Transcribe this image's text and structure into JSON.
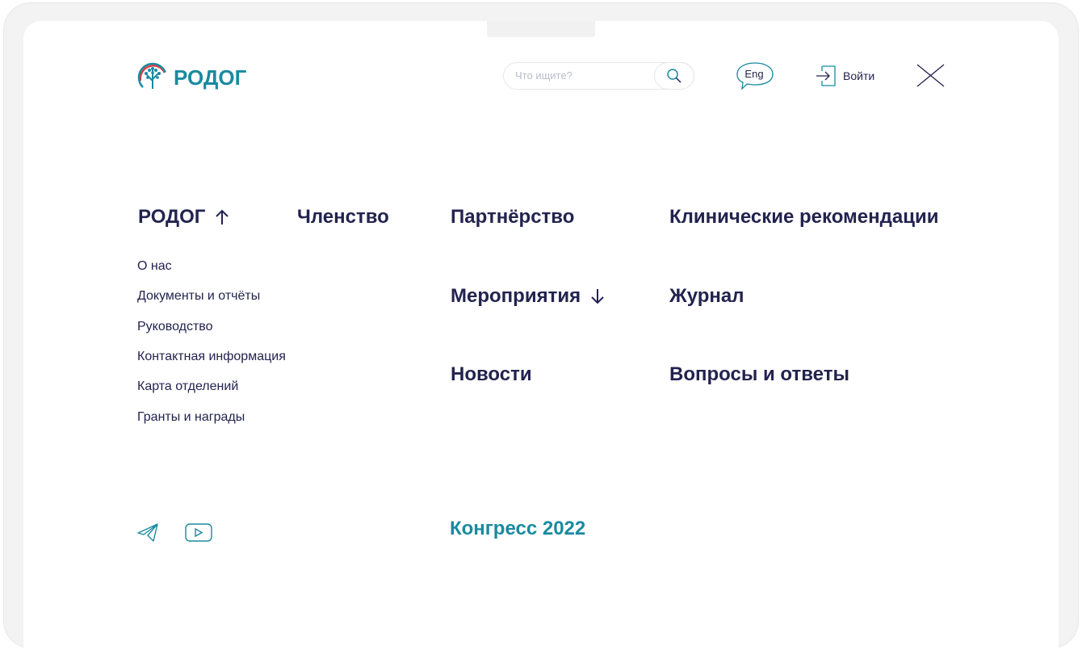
{
  "header": {
    "logo_text": "РОДОГ",
    "search_placeholder": "Что ищите?",
    "lang_label": "Eng",
    "login_label": "Войти"
  },
  "menu": {
    "rodog": {
      "label": "РОДОГ",
      "items": [
        "О нас",
        "Документы и отчёты",
        "Руководство",
        "Контактная информация",
        "Карта отделений",
        "Гранты и награды"
      ]
    },
    "membership": "Членство",
    "partnership": "Партнёрство",
    "events": "Мероприятия",
    "news": "Новости",
    "clinical": "Клинические рекомендации",
    "journal": "Журнал",
    "faq": "Вопросы и ответы"
  },
  "footer": {
    "congress": "Конгресс 2022"
  },
  "colors": {
    "navy": "#23234f",
    "teal": "#1a8aa0",
    "red": "#e03a3e"
  }
}
